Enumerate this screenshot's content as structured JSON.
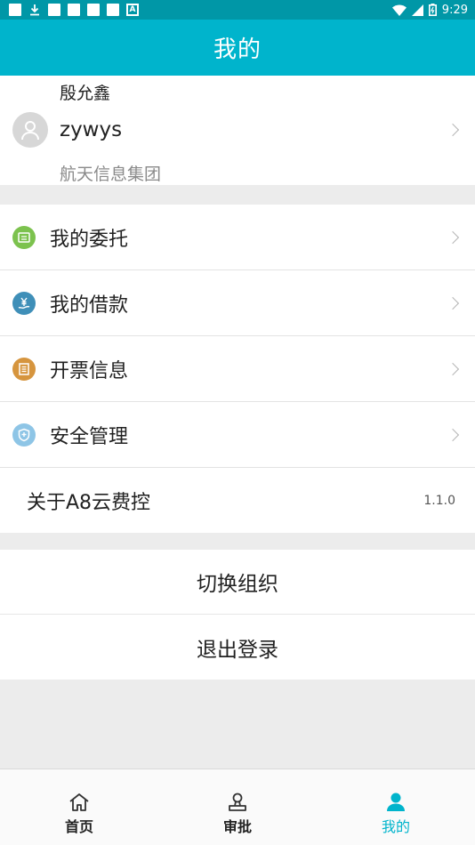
{
  "status_bar": {
    "time": "9:29",
    "icons": [
      "notification-square",
      "download-icon",
      "notification-square",
      "notification-square",
      "notification-square",
      "notification-square",
      "app-a-icon",
      "wifi-icon",
      "signal-icon",
      "battery-icon"
    ]
  },
  "header": {
    "title": "我的"
  },
  "profile": {
    "name": "殷允鑫",
    "username": "zywys",
    "organization": "航天信息集团"
  },
  "menu": {
    "items": [
      {
        "label": "我的委托",
        "icon": "delegation-icon",
        "color": "#7cc24e"
      },
      {
        "label": "我的借款",
        "icon": "loan-yen-icon",
        "color": "#3f8fb8"
      },
      {
        "label": "开票信息",
        "icon": "invoice-icon",
        "color": "#d6953e"
      },
      {
        "label": "安全管理",
        "icon": "security-shield-icon",
        "color": "#8ec5e6"
      }
    ],
    "about": {
      "label": "关于A8云费控",
      "version": "1.1.0"
    }
  },
  "actions": {
    "switch_org": "切换组织",
    "logout": "退出登录"
  },
  "tabs": [
    {
      "label": "首页",
      "icon": "home-icon"
    },
    {
      "label": "审批",
      "icon": "approval-stamp-icon"
    },
    {
      "label": "我的",
      "icon": "user-icon",
      "active": true
    }
  ],
  "colors": {
    "accent": "#00b4cc",
    "statusbar": "#0097a7"
  }
}
